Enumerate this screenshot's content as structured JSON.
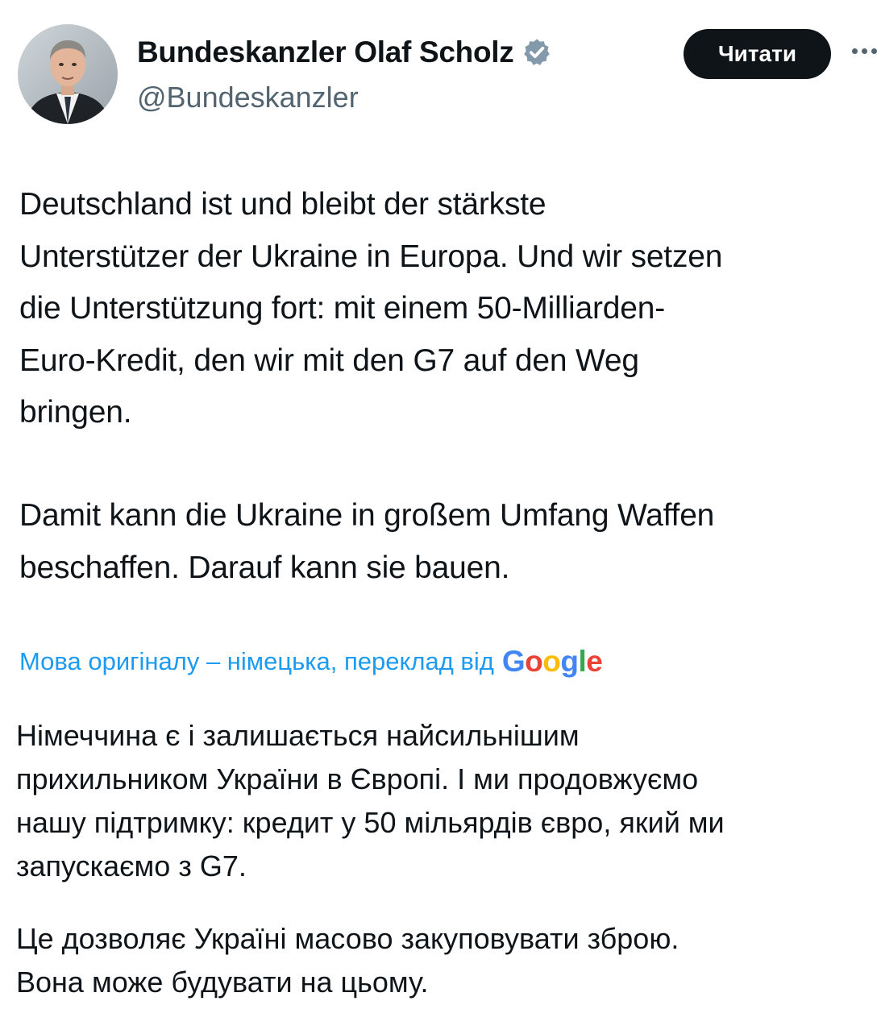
{
  "author": {
    "display_name": "Bundeskanzler Olaf Scholz",
    "handle": "@Bundeskanzler",
    "avatar_icon": "avatar-photo",
    "verified_icon": "verified-badge-icon"
  },
  "actions": {
    "follow_label": "Читати",
    "more_icon": "more-dots-icon"
  },
  "tweet": {
    "paragraph1": "Deutschland ist und bleibt der stärkste\nUnterstützer der Ukraine in Europa. Und wir setzen\ndie Unterstützung fort: mit einem 50-Milliarden-\nEuro-Kredit, den wir mit den G7 auf den Weg\nbringen.",
    "paragraph2": "Damit kann die Ukraine in großem Umfang Waffen\nbeschaffen. Darauf kann sie bauen."
  },
  "translation": {
    "source_note": "Мова оригіналу – німецька, переклад від",
    "provider": "Google",
    "paragraph1": "Німеччина є і залишається найсильнішим\nприхильником України в Європі. І ми продовжуємо\nнашу підтримку: кредит у 50 мільярдів євро, який ми\nзапускаємо з G7.",
    "paragraph2": "Це дозволяє Україні масово закуповувати зброю.\nВона може будувати на цьому."
  },
  "colors": {
    "text": "#0f1419",
    "secondary": "#536471",
    "link": "#1d9bf0",
    "button_bg": "#0f1419",
    "verified": "#829aab"
  }
}
